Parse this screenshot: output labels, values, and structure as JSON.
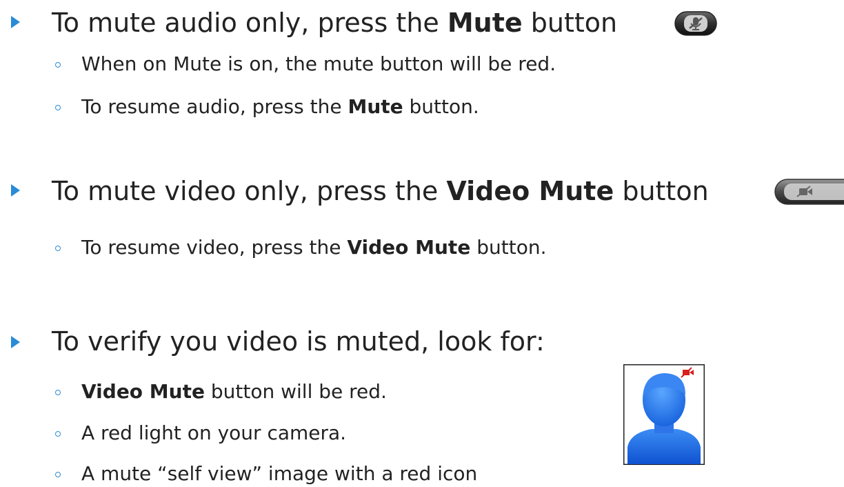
{
  "bullets": [
    {
      "text_parts": [
        "To mute audio only, press the ",
        "Mute",
        " button"
      ],
      "sub": [
        {
          "text_parts": [
            "When on Mute is on, the mute button will be red."
          ]
        },
        {
          "text_parts": [
            "To resume audio, press the ",
            "Mute",
            " button."
          ]
        }
      ]
    },
    {
      "text_parts": [
        "To mute video only, press the ",
        "Video Mute",
        " button"
      ],
      "sub": [
        {
          "text_parts": [
            "To resume video, press the ",
            "Video Mute",
            " button."
          ]
        }
      ]
    },
    {
      "text_parts": [
        "To verify you video is muted, look for:"
      ],
      "sub": [
        {
          "text_parts": [
            "Video Mute",
            " button will be red."
          ]
        },
        {
          "text_parts": [
            "A red light on your camera."
          ]
        },
        {
          "text_parts": [
            "A mute “self view” image with a red icon"
          ]
        }
      ]
    }
  ],
  "icons": {
    "audio_mute_button": "mic-mute-icon",
    "video_mute_button": "video-mute-icon",
    "self_view_image": "self-view-avatar-icon"
  },
  "colors": {
    "bullet": "#2a8bd6",
    "mute_red": "#d81e1e",
    "avatar_blue": "#1a66e0"
  }
}
